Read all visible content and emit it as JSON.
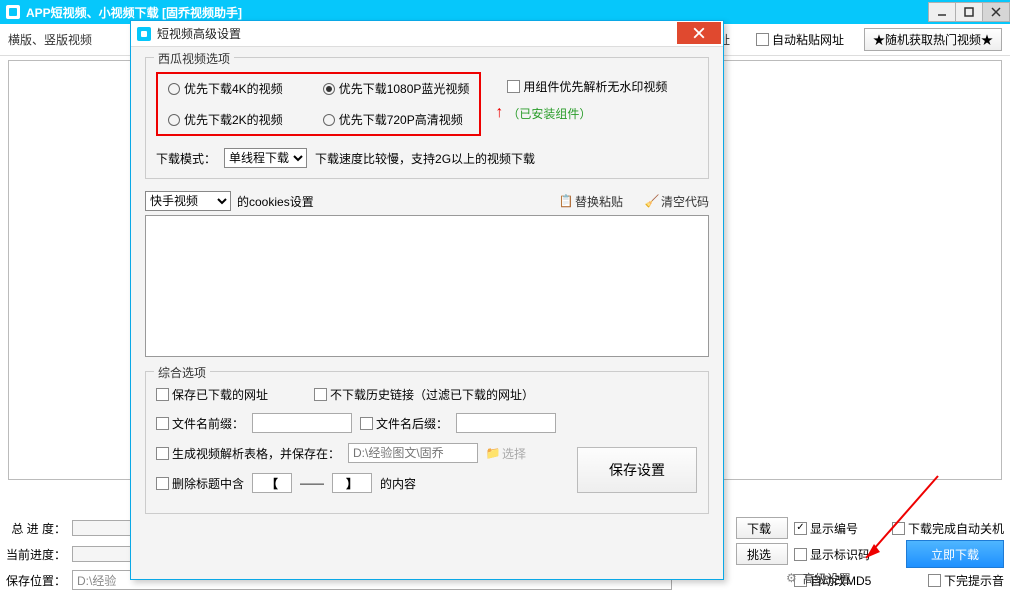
{
  "main_title": "APP短视频、小视频下载 [固乔视频助手]",
  "toolbar": {
    "format_label": "横版、竖版视频",
    "partial_label": "址",
    "auto_paste": "自动粘贴网址",
    "random_btn": "★随机获取热门视频★"
  },
  "bottom": {
    "total_progress_label": "总 进 度：",
    "current_progress_label": "当前进度：",
    "save_location_label": "保存位置：",
    "save_location_value": "D:\\经验",
    "download_btn": "下载",
    "pick_btn": "挑选",
    "show_index": "显示编号",
    "show_id": "显示标识码",
    "auto_md5": "自动改MD5",
    "advanced_link": "高级设置",
    "auto_shutdown": "下载完成自动关机",
    "download_now": "立即下载",
    "no_sound": "下完提示音"
  },
  "dialog": {
    "title": "短视频高级设置",
    "xigua_group": "西瓜视频选项",
    "radio_4k": "优先下载4K的视频",
    "radio_1080p": "优先下载1080P蓝光视频",
    "radio_2k": "优先下载2K的视频",
    "radio_720p": "优先下载720P高清视频",
    "use_component": "用组件优先解析无水印视频",
    "installed": "（已安装组件）",
    "mode_label": "下载模式：",
    "mode_opt": "单线程下载",
    "mode_hint": "下载速度比较慢，支持2G以上的视频下载",
    "cookies_src": "快手视频",
    "cookies_label": "的cookies设置",
    "paste_replace": "替换粘贴",
    "clear_code": "清空代码",
    "comp_group": "综合选项",
    "save_downloaded": "保存已下载的网址",
    "skip_history": "不下载历史链接（过滤已下载的网址）",
    "prefix_label": "文件名前缀：",
    "suffix_label": "文件名后缀：",
    "gen_table": "生成视频解析表格，并保存在：",
    "gen_path_placeholder": "D:\\经验图文\\固乔",
    "select_btn": "选择",
    "remove_title": "删除标题中含",
    "bracket_l": "【",
    "dashes": "——",
    "bracket_r": "】",
    "remove_suffix": "的内容",
    "save_settings": "保存设置"
  }
}
